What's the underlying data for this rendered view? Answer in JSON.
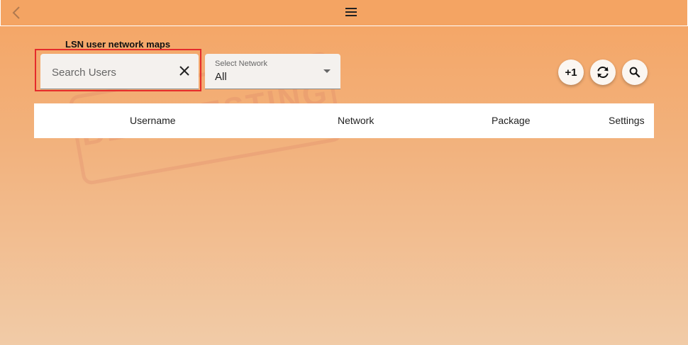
{
  "header": {
    "back_icon": "chevron-left-icon",
    "menu_icon": "hamburger-menu-icon"
  },
  "page": {
    "title": "LSN user network maps"
  },
  "search": {
    "placeholder": "Search Users",
    "value": "",
    "clear_icon": "close-icon",
    "highlight_color": "#e52b2b"
  },
  "network_select": {
    "label": "Select Network",
    "selected": "All",
    "caret_icon": "caret-down-icon"
  },
  "actions": {
    "add_label": "+1",
    "refresh_icon": "refresh-icon",
    "search_icon": "search-icon"
  },
  "table": {
    "columns": [
      "Username",
      "Network",
      "Package",
      "Settings"
    ]
  },
  "watermark": {
    "text": "BETA TESTING"
  },
  "colors": {
    "accent": "#f4a463",
    "background_light": "#f1cba7"
  }
}
